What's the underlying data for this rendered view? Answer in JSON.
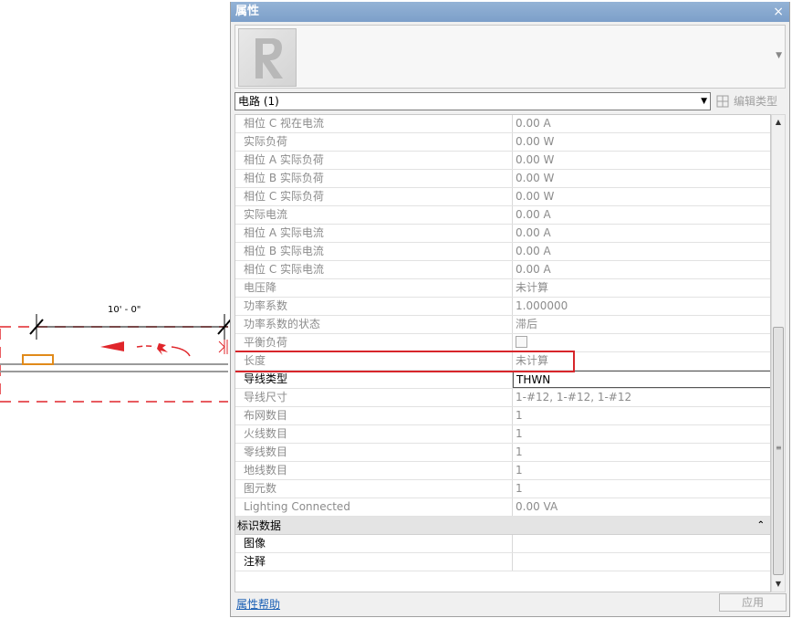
{
  "canvas": {
    "dimension_label": "10' - 0\""
  },
  "palette": {
    "title": "属性",
    "close_glyph": "×",
    "type_selector": "电路 (1)",
    "edit_type_label": "编辑类型",
    "help_link": "属性帮助",
    "apply_button": "应用",
    "rows": [
      {
        "label": "相位 C 视在电流",
        "value": "0.00 A"
      },
      {
        "label": "实际负荷",
        "value": "0.00 W"
      },
      {
        "label": "相位 A 实际负荷",
        "value": "0.00 W"
      },
      {
        "label": "相位 B 实际负荷",
        "value": "0.00 W"
      },
      {
        "label": "相位 C 实际负荷",
        "value": "0.00 W"
      },
      {
        "label": "实际电流",
        "value": "0.00 A"
      },
      {
        "label": "相位 A 实际电流",
        "value": "0.00 A"
      },
      {
        "label": "相位 B 实际电流",
        "value": "0.00 A"
      },
      {
        "label": "相位 C 实际电流",
        "value": "0.00 A"
      },
      {
        "label": "电压降",
        "value": "未计算"
      },
      {
        "label": "功率系数",
        "value": "1.000000"
      },
      {
        "label": "功率系数的状态",
        "value": "滞后"
      },
      {
        "label": "平衡负荷",
        "value": ""
      },
      {
        "label": "长度",
        "value": "未计算"
      },
      {
        "label": "导线类型",
        "value": "THWN"
      },
      {
        "label": "导线尺寸",
        "value": "1-#12, 1-#12, 1-#12"
      },
      {
        "label": "布网数目",
        "value": "1"
      },
      {
        "label": "火线数目",
        "value": "1"
      },
      {
        "label": "零线数目",
        "value": "1"
      },
      {
        "label": "地线数目",
        "value": "1"
      },
      {
        "label": "图元数",
        "value": "1"
      },
      {
        "label": "Lighting Connected",
        "value": "0.00 VA"
      }
    ],
    "group": {
      "label": "标识数据",
      "collapse_glyph": "⌃",
      "rows": [
        {
          "label": "图像",
          "value": ""
        },
        {
          "label": "注释",
          "value": ""
        }
      ]
    }
  }
}
